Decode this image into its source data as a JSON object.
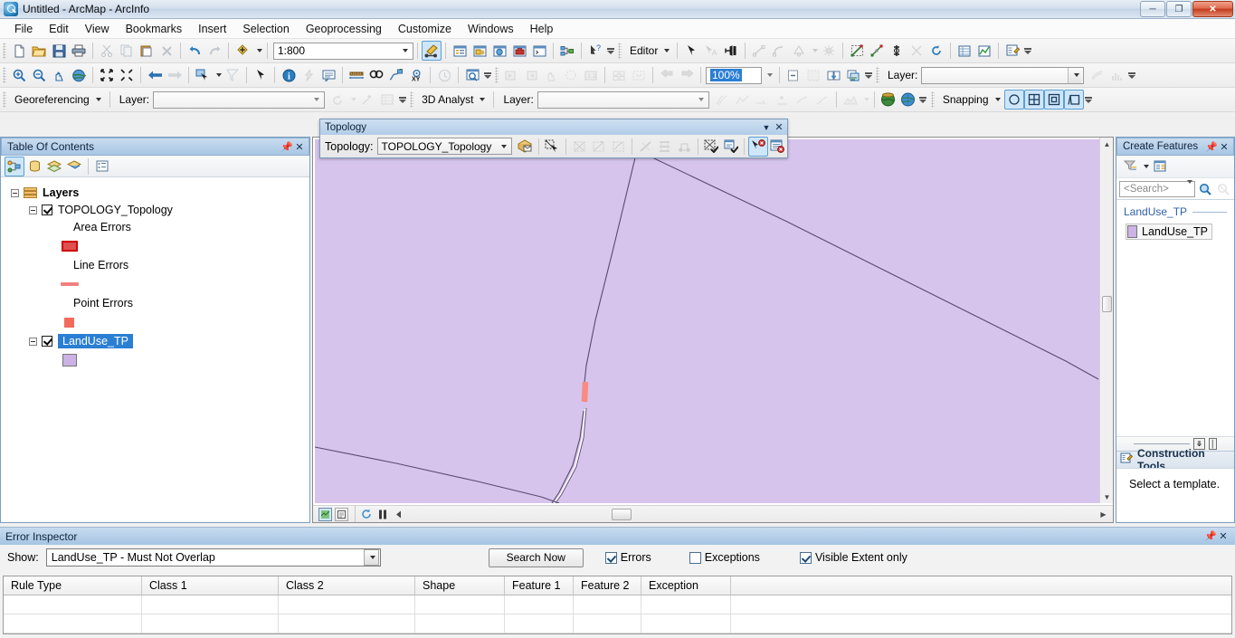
{
  "window": {
    "title": "Untitled - ArcMap - ArcInfo",
    "icon": "arcmap-globe-icon",
    "buttons": {
      "minimize": "minimize-icon",
      "restore": "restore-icon",
      "close": "close-icon"
    }
  },
  "menubar": {
    "items": [
      "File",
      "Edit",
      "View",
      "Bookmarks",
      "Insert",
      "Selection",
      "Geoprocessing",
      "Customize",
      "Windows",
      "Help"
    ]
  },
  "standard_toolbar": {
    "scale_value": "1:800",
    "buttons": [
      "new-document-icon",
      "open-folder-icon",
      "save-icon",
      "print-icon",
      "cut-icon",
      "copy-icon",
      "paste-icon",
      "delete-icon",
      "undo-icon",
      "redo-icon",
      "add-data-icon"
    ],
    "after_scale": [
      "editor-toolbar-icon",
      "table-of-contents-icon",
      "catalog-icon",
      "search-icon",
      "arctoolbox-icon",
      "python-window-icon",
      "model-builder-icon",
      "whats-this-help-icon"
    ]
  },
  "tools_toolbar": {
    "buttons": [
      "zoom-in-icon",
      "zoom-out-icon",
      "pan-icon",
      "full-extent-icon",
      "fixed-zoom-in-icon",
      "fixed-zoom-out-icon",
      "go-back-extent-icon",
      "go-forward-extent-icon",
      "select-features-icon",
      "clear-selection-icon",
      "select-elements-icon",
      "identify-icon",
      "hyperlink-icon",
      "html-popup-icon",
      "measure-icon",
      "find-icon",
      "find-route-icon",
      "go-to-xy-icon",
      "time-slider-icon",
      "create-viewer-window-icon"
    ]
  },
  "editor_toolbar": {
    "label": "Editor",
    "zoom_value": "100%",
    "buttons": [
      "edit-tool-icon",
      "edit-annotation-icon",
      "attributes-split-icon",
      "straight-segment-icon",
      "endpoint-arc-icon",
      "trace-icon",
      "midpoint-icon",
      "construction-icon",
      "rotate-icon",
      "merge-icon",
      "attributes-icon",
      "sketch-properties-icon"
    ]
  },
  "georeferencing_toolbar": {
    "label": "Georeferencing",
    "layer_label": "Layer:",
    "layer_value": ""
  },
  "analyst3d_toolbar": {
    "label": "3D Analyst",
    "layer_label": "Layer:",
    "layer_value": ""
  },
  "snapping_toolbar": {
    "label": "Snapping",
    "modes": [
      "point-snap-icon",
      "vertex-snap-icon",
      "edge-snap-icon",
      "end-snap-icon"
    ]
  },
  "toc": {
    "title": "Table Of Contents",
    "pin": "pin-icon",
    "close": "close-icon",
    "toolbar_buttons": [
      "list-by-drawing-order-icon",
      "list-by-source-icon",
      "list-by-visibility-icon",
      "list-by-selection-icon",
      "options-icon"
    ],
    "root": "Layers",
    "nodes": [
      {
        "label": "TOPOLOGY_Topology",
        "checked": true,
        "selected": false
      },
      {
        "label": "Area Errors",
        "symbol": "area-error-symbol"
      },
      {
        "label": "Line Errors",
        "symbol": "line-error-symbol"
      },
      {
        "label": "Point Errors",
        "symbol": "point-error-symbol"
      },
      {
        "label": "LandUse_TP",
        "checked": true,
        "selected": true,
        "symbol": "polygon-symbol"
      }
    ]
  },
  "topology_toolbar": {
    "title": "Topology",
    "label": "Topology:",
    "selected_topology": "TOPOLOGY_Topology",
    "options": [
      "TOPOLOGY_Topology"
    ],
    "buttons": [
      "topology-properties-icon",
      "select-topology-elements-icon",
      "show-shared-features-icon",
      "modify-edge-icon",
      "reshape-edge-icon",
      "construct-features-icon",
      "planarize-lines-icon",
      "create-new-polygon-icon",
      "validate-topology-in-extent-icon",
      "validate-entire-topology-icon",
      "fix-topology-error-tool-icon",
      "error-inspector-icon"
    ],
    "minimize": "chevron-down-icon",
    "close": "close-icon"
  },
  "map": {
    "background_color": "#d6c4ec",
    "polygon_fill": "#d6c4ec",
    "boundary_color": "#5b4a6e",
    "error_color": "#f98a80",
    "status_buttons": [
      "data-view-icon",
      "layout-view-icon",
      "refresh-icon",
      "pause-drawing-icon",
      "previous-icon"
    ]
  },
  "create_features": {
    "title": "Create Features",
    "pin": "pin-icon",
    "close": "close-icon",
    "toolbar_buttons": [
      "filter-templates-icon",
      "organize-templates-icon"
    ],
    "search_placeholder": "<Search>",
    "search_button": "search-icon",
    "clear_search_button": "clear-search-icon",
    "template_group": "LandUse_TP",
    "templates": [
      {
        "label": "LandUse_TP",
        "symbol": "polygon-symbol"
      }
    ],
    "construction_tools_title": "Construction Tools",
    "construction_tools_icon": "construction-tools-icon",
    "construction_tools_message": "Select a template."
  },
  "error_inspector": {
    "title": "Error Inspector",
    "pin": "pin-icon",
    "close": "close-icon",
    "show_label": "Show:",
    "show_value": "LandUse_TP - Must Not Overlap",
    "search_button": "Search Now",
    "checkboxes": [
      {
        "label": "Errors",
        "checked": true
      },
      {
        "label": "Exceptions",
        "checked": false
      },
      {
        "label": "Visible Extent only",
        "checked": true
      }
    ],
    "columns": [
      "Rule Type",
      "Class 1",
      "Class 2",
      "Shape",
      "Feature 1",
      "Feature 2",
      "Exception"
    ],
    "rows": []
  }
}
